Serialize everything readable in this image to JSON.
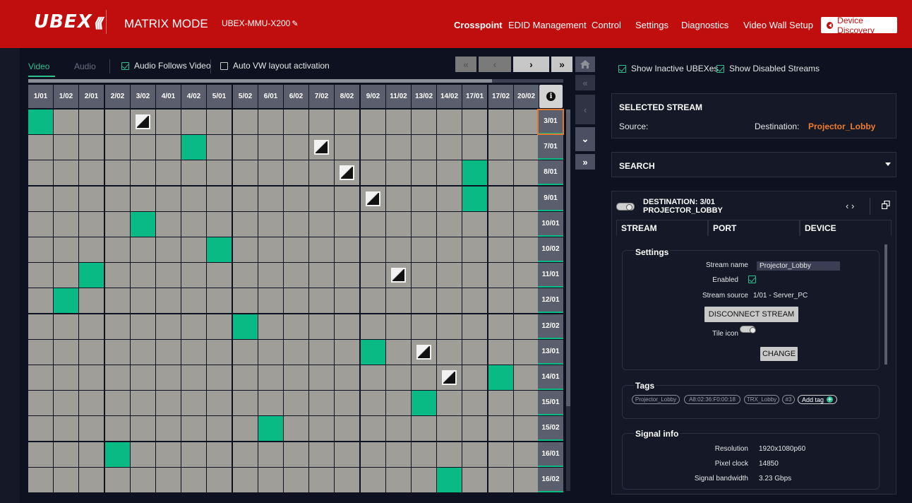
{
  "header": {
    "logo": "UBEX",
    "mode": "MATRIX MODE",
    "device_name": "UBEX-MMU-X200",
    "nav": [
      "Crosspoint",
      "EDID Management",
      "Control",
      "Settings",
      "Diagnostics",
      "Video Wall Setup"
    ],
    "active_nav": "Crosspoint",
    "device_discovery": "Device Discovery",
    "accent_color": "#c00d0d"
  },
  "toolbar": {
    "tab_video": "Video",
    "tab_audio": "Audio",
    "audio_follows_video": "Audio Follows Video",
    "audio_follows_video_checked": true,
    "auto_vw_layout": "Auto VW layout activation",
    "auto_vw_layout_checked": false,
    "page_buttons": [
      "«",
      "‹",
      "›",
      "»"
    ]
  },
  "grid": {
    "columns": [
      "1/01",
      "1/02",
      "2/01",
      "2/02",
      "3/02",
      "4/01",
      "4/02",
      "5/01",
      "5/02",
      "6/01",
      "6/02",
      "7/02",
      "8/02",
      "9/02",
      "11/02",
      "13/02",
      "14/02",
      "17/01",
      "17/02",
      "20/02"
    ],
    "rows": [
      "3/01",
      "7/01",
      "8/01",
      "9/01",
      "10/01",
      "10/02",
      "11/01",
      "12/01",
      "12/02",
      "13/01",
      "14/01",
      "15/01",
      "15/02",
      "16/01",
      "16/02"
    ],
    "selected_row": "3/01",
    "connections": [
      [
        0,
        0
      ],
      [
        1,
        6
      ],
      [
        2,
        17
      ],
      [
        3,
        17
      ],
      [
        4,
        4
      ],
      [
        5,
        7
      ],
      [
        6,
        2
      ],
      [
        7,
        1
      ],
      [
        8,
        8
      ],
      [
        9,
        13
      ],
      [
        10,
        18
      ],
      [
        11,
        15
      ],
      [
        12,
        9
      ],
      [
        13,
        3
      ],
      [
        14,
        16
      ]
    ],
    "self_cells": [
      [
        0,
        4
      ],
      [
        1,
        11
      ],
      [
        2,
        12
      ],
      [
        3,
        13
      ],
      [
        6,
        14
      ],
      [
        9,
        15
      ],
      [
        10,
        16
      ]
    ],
    "connected_color": "#0aba85",
    "cell_color": "#a09e98"
  },
  "right": {
    "show_inactive": "Show Inactive UBEXes",
    "show_disabled": "Show Disabled Streams",
    "selected_stream_title": "SELECTED STREAM",
    "source_label": "Source:",
    "destination_label": "Destination:",
    "destination_value": "Projector_Lobby",
    "search_title": "SEARCH",
    "destination_header_line1": "DESTINATION: 3/01",
    "destination_header_line2": "PROJECTOR_LOBBY",
    "nav_arrows": "‹ ›",
    "tabs": [
      "STREAM",
      "PORT",
      "DEVICE"
    ],
    "settings": {
      "title": "Settings",
      "stream_name_label": "Stream name",
      "stream_name_value": "Projector_Lobby",
      "enabled_label": "Enabled",
      "stream_source_label": "Stream source",
      "stream_source_value": "1/01 - Server_PC",
      "disconnect_label": "DISCONNECT STREAM",
      "tile_icon_label": "Tile icon",
      "change_label": "CHANGE"
    },
    "tags": {
      "title": "Tags",
      "items": [
        "Projector_Lobby",
        "A8:02:36:F0:00:18",
        "TRX_Lobby",
        "#3"
      ],
      "add_label": "Add tag"
    },
    "signal": {
      "title": "Signal info",
      "resolution_label": "Resolution",
      "resolution_value": "1920x1080p60",
      "pixel_clock_label": "Pixel clock",
      "pixel_clock_value": "14850",
      "bandwidth_label": "Signal bandwidth",
      "bandwidth_value": "3.23 Gbps"
    }
  }
}
